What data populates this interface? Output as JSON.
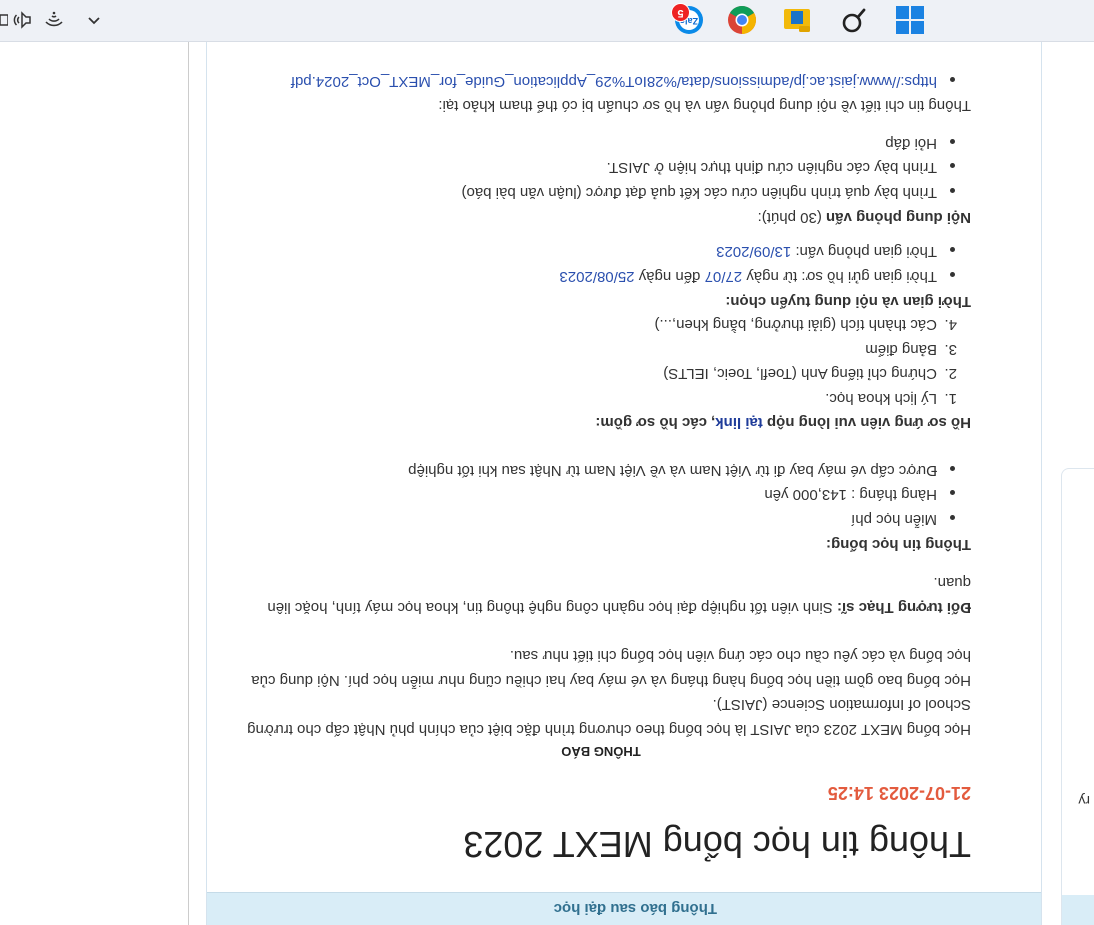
{
  "card": {
    "header_title": "Thông báo sau đại học",
    "title": "Thông tin học bổng MEXT 2023",
    "date": "21-07-2023 14:25",
    "notice_heading": "THÔNG BÁO",
    "intro_lines": [
      "Học bổng MEXT 2023 của JAIST là học bổng theo chương trình đặc biệt của chính phủ Nhật cấp cho trường",
      "School of Information Science (JAIST).",
      "Học bổng bao gồm tiền học bổng hàng tháng và vé máy bay hai chiều cũng như miễn học phí. Nội dung của",
      "học bổng và các yêu cầu cho các ứng viên học bổng chi tiết như sau."
    ],
    "target_label": "Đối tượng Thạc sĩ:",
    "target_line1": " Sinh viên tốt nghiệp đại học ngành công nghệ thông tin, khoa học máy tính, hoặc liên",
    "target_line2": "quan.",
    "scholarship_heading": "Thông tin học bổng:",
    "scholarship_items": [
      "Miễn học phí",
      "Hàng tháng : 143,000 yên",
      "Được cấp vé máy bay đi từ Việt Nam và về Việt Nam từ Nhật sau khi tốt nghiệp"
    ],
    "docs_heading_prefix": "Hồ sơ ứng viên vui lòng nộp ",
    "docs_heading_link": "tại link",
    "docs_heading_suffix": ", các hồ sơ gồm:",
    "docs_items": [
      "Lý lịch khoa học.",
      "Chứng chỉ tiếng Anh (Toefl, Toeic, IELTS)",
      "Bảng điểm",
      "Các thành tích (giải thưởng, bằng khen,...)"
    ],
    "time_heading": "Thời gian và nội dung tuyển chọn:",
    "time_item1_prefix": "Thời gian gửi hồ sơ: từ ngày ",
    "time_item1_d1": "27/07",
    "time_item1_mid": " đến ngày ",
    "time_item1_d2": "25/08/2023",
    "time_item2_prefix": "Thời gian phỏng vấn: ",
    "time_item2_d": "13/09/2023",
    "interview_heading": "Nội dung phỏng vấn",
    "interview_duration": " (30 phút):",
    "interview_items": [
      "Trình bày quá trình nghiên cứu các kết quả đạt được (luận văn bài báo)",
      "Trình bày các nghiên cứu định thực hiện ở JAIST.",
      "Hỏi đáp"
    ],
    "details_line": "Thông tin chi tiết về nội dung phỏng vấn và hồ sơ chuẩn bị có thể tham khảo tại:",
    "details_link": "https://www.jaist.ac.jp/admissions/data/%28IoT%29_Application_Guide_for_MEXT_Oct_2024.pdf"
  },
  "sidebar": {
    "fragment": "ry"
  },
  "taskbar": {
    "zalo_label": "Zalo",
    "zalo_badge": "5"
  }
}
